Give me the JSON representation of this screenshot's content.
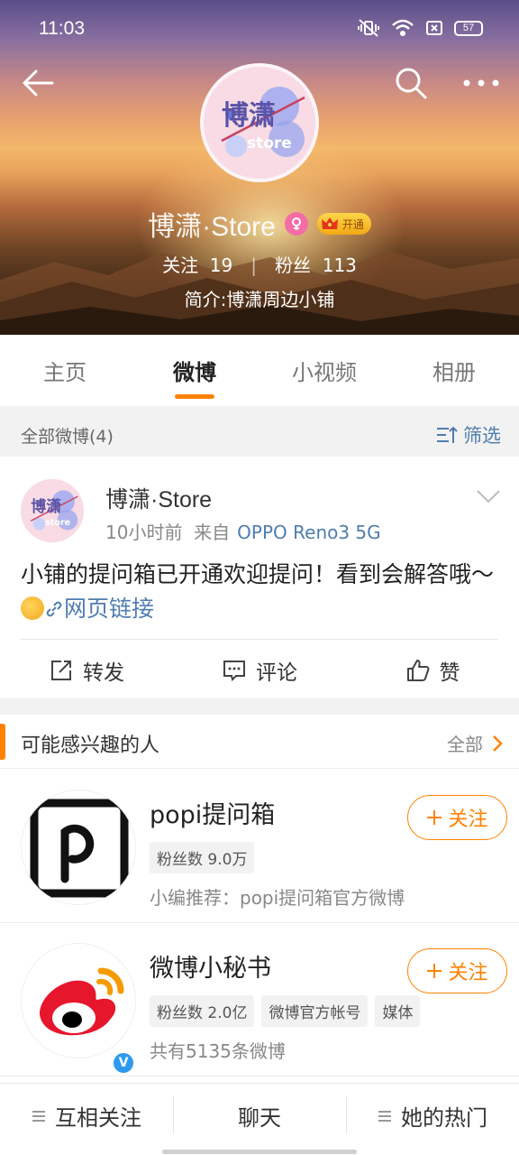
{
  "status_bar": {
    "time": "11:03",
    "battery": "57"
  },
  "profile": {
    "name": "博潇·Store",
    "vip_label": "开通",
    "following_label": "关注",
    "following_count": "19",
    "followers_label": "粉丝",
    "followers_count": "113",
    "bio": "简介:博潇周边小铺",
    "avatar_text": "博潇",
    "avatar_subtext": "store"
  },
  "tabs": [
    "主页",
    "微博",
    "小视频",
    "相册"
  ],
  "active_tab": 1,
  "filter": {
    "count_label": "全部微博(4)",
    "filter_label": "筛选"
  },
  "post": {
    "author": "博潇·Store",
    "time": "10小时前",
    "source_prefix": "来自",
    "source": "OPPO Reno3 5G",
    "text": "小铺的提问箱已开通欢迎提问！看到会解答哦～",
    "link_text": "网页链接",
    "actions": {
      "repost": "转发",
      "comment": "评论",
      "like": "赞"
    }
  },
  "recommend": {
    "title": "可能感兴趣的人",
    "all_label": "全部",
    "people": [
      {
        "name": "popi提问箱",
        "tags": [
          "粉丝数 9.0万"
        ],
        "desc": "小编推荐：popi提问箱官方微博",
        "follow_label": "关注"
      },
      {
        "name": "微博小秘书",
        "tags": [
          "粉丝数 2.0亿",
          "微博官方帐号",
          "媒体"
        ],
        "desc": "共有5135条微博",
        "follow_label": "关注",
        "verified_mark": "V"
      }
    ]
  },
  "bottom_bar": {
    "mutual": "互相关注",
    "chat": "聊天",
    "hot": "她的热门"
  },
  "colors": {
    "accent": "#ff8200",
    "link": "#507daf"
  }
}
